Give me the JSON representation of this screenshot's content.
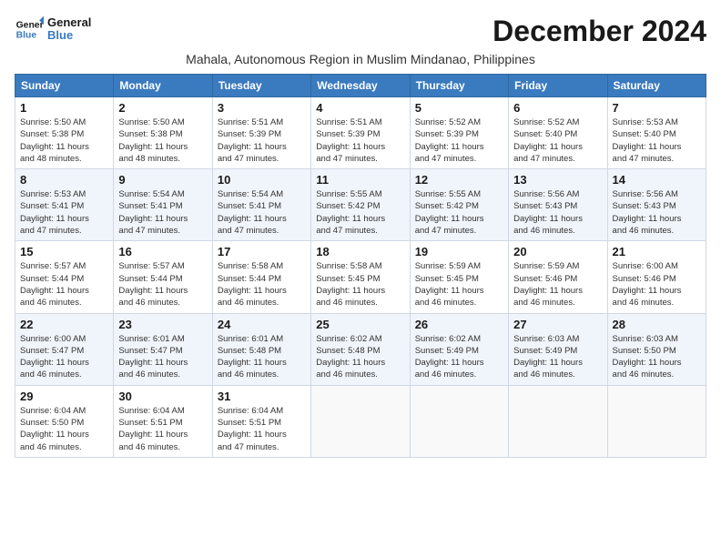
{
  "logo": {
    "line1": "General",
    "line2": "Blue"
  },
  "title": "December 2024",
  "subtitle": "Mahala, Autonomous Region in Muslim Mindanao, Philippines",
  "days_of_week": [
    "Sunday",
    "Monday",
    "Tuesday",
    "Wednesday",
    "Thursday",
    "Friday",
    "Saturday"
  ],
  "weeks": [
    [
      {
        "day": "1",
        "info": "Sunrise: 5:50 AM\nSunset: 5:38 PM\nDaylight: 11 hours\nand 48 minutes."
      },
      {
        "day": "2",
        "info": "Sunrise: 5:50 AM\nSunset: 5:38 PM\nDaylight: 11 hours\nand 48 minutes."
      },
      {
        "day": "3",
        "info": "Sunrise: 5:51 AM\nSunset: 5:39 PM\nDaylight: 11 hours\nand 47 minutes."
      },
      {
        "day": "4",
        "info": "Sunrise: 5:51 AM\nSunset: 5:39 PM\nDaylight: 11 hours\nand 47 minutes."
      },
      {
        "day": "5",
        "info": "Sunrise: 5:52 AM\nSunset: 5:39 PM\nDaylight: 11 hours\nand 47 minutes."
      },
      {
        "day": "6",
        "info": "Sunrise: 5:52 AM\nSunset: 5:40 PM\nDaylight: 11 hours\nand 47 minutes."
      },
      {
        "day": "7",
        "info": "Sunrise: 5:53 AM\nSunset: 5:40 PM\nDaylight: 11 hours\nand 47 minutes."
      }
    ],
    [
      {
        "day": "8",
        "info": "Sunrise: 5:53 AM\nSunset: 5:41 PM\nDaylight: 11 hours\nand 47 minutes."
      },
      {
        "day": "9",
        "info": "Sunrise: 5:54 AM\nSunset: 5:41 PM\nDaylight: 11 hours\nand 47 minutes."
      },
      {
        "day": "10",
        "info": "Sunrise: 5:54 AM\nSunset: 5:41 PM\nDaylight: 11 hours\nand 47 minutes."
      },
      {
        "day": "11",
        "info": "Sunrise: 5:55 AM\nSunset: 5:42 PM\nDaylight: 11 hours\nand 47 minutes."
      },
      {
        "day": "12",
        "info": "Sunrise: 5:55 AM\nSunset: 5:42 PM\nDaylight: 11 hours\nand 47 minutes."
      },
      {
        "day": "13",
        "info": "Sunrise: 5:56 AM\nSunset: 5:43 PM\nDaylight: 11 hours\nand 46 minutes."
      },
      {
        "day": "14",
        "info": "Sunrise: 5:56 AM\nSunset: 5:43 PM\nDaylight: 11 hours\nand 46 minutes."
      }
    ],
    [
      {
        "day": "15",
        "info": "Sunrise: 5:57 AM\nSunset: 5:44 PM\nDaylight: 11 hours\nand 46 minutes."
      },
      {
        "day": "16",
        "info": "Sunrise: 5:57 AM\nSunset: 5:44 PM\nDaylight: 11 hours\nand 46 minutes."
      },
      {
        "day": "17",
        "info": "Sunrise: 5:58 AM\nSunset: 5:44 PM\nDaylight: 11 hours\nand 46 minutes."
      },
      {
        "day": "18",
        "info": "Sunrise: 5:58 AM\nSunset: 5:45 PM\nDaylight: 11 hours\nand 46 minutes."
      },
      {
        "day": "19",
        "info": "Sunrise: 5:59 AM\nSunset: 5:45 PM\nDaylight: 11 hours\nand 46 minutes."
      },
      {
        "day": "20",
        "info": "Sunrise: 5:59 AM\nSunset: 5:46 PM\nDaylight: 11 hours\nand 46 minutes."
      },
      {
        "day": "21",
        "info": "Sunrise: 6:00 AM\nSunset: 5:46 PM\nDaylight: 11 hours\nand 46 minutes."
      }
    ],
    [
      {
        "day": "22",
        "info": "Sunrise: 6:00 AM\nSunset: 5:47 PM\nDaylight: 11 hours\nand 46 minutes."
      },
      {
        "day": "23",
        "info": "Sunrise: 6:01 AM\nSunset: 5:47 PM\nDaylight: 11 hours\nand 46 minutes."
      },
      {
        "day": "24",
        "info": "Sunrise: 6:01 AM\nSunset: 5:48 PM\nDaylight: 11 hours\nand 46 minutes."
      },
      {
        "day": "25",
        "info": "Sunrise: 6:02 AM\nSunset: 5:48 PM\nDaylight: 11 hours\nand 46 minutes."
      },
      {
        "day": "26",
        "info": "Sunrise: 6:02 AM\nSunset: 5:49 PM\nDaylight: 11 hours\nand 46 minutes."
      },
      {
        "day": "27",
        "info": "Sunrise: 6:03 AM\nSunset: 5:49 PM\nDaylight: 11 hours\nand 46 minutes."
      },
      {
        "day": "28",
        "info": "Sunrise: 6:03 AM\nSunset: 5:50 PM\nDaylight: 11 hours\nand 46 minutes."
      }
    ],
    [
      {
        "day": "29",
        "info": "Sunrise: 6:04 AM\nSunset: 5:50 PM\nDaylight: 11 hours\nand 46 minutes."
      },
      {
        "day": "30",
        "info": "Sunrise: 6:04 AM\nSunset: 5:51 PM\nDaylight: 11 hours\nand 46 minutes."
      },
      {
        "day": "31",
        "info": "Sunrise: 6:04 AM\nSunset: 5:51 PM\nDaylight: 11 hours\nand 47 minutes."
      },
      {
        "day": "",
        "info": ""
      },
      {
        "day": "",
        "info": ""
      },
      {
        "day": "",
        "info": ""
      },
      {
        "day": "",
        "info": ""
      }
    ]
  ]
}
